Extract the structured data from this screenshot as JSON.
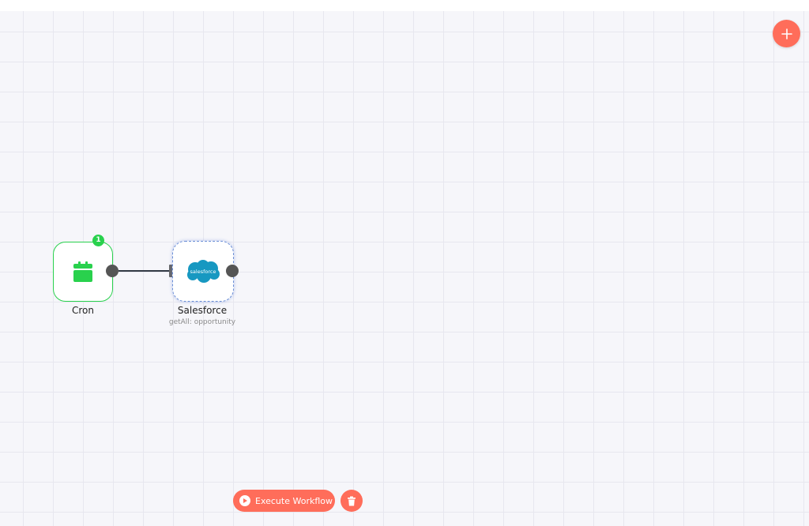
{
  "canvas": {
    "background_color": "#f6f6fa",
    "grid_color": "#e7e7ef"
  },
  "toolbar": {
    "add_node_icon": "plus-icon",
    "accent_color": "#ff6d5a"
  },
  "nodes": [
    {
      "label": "Cron",
      "subtitle": "",
      "icon": "calendar-icon",
      "icon_color": "#29d14d",
      "badge": "1",
      "border_color": "#29d14d"
    },
    {
      "label": "Salesforce",
      "subtitle": "getAll: opportunity",
      "icon": "salesforce-logo-icon",
      "logo_text": "salesforce",
      "logo_color": "#1798c1",
      "selected": true
    }
  ],
  "connection": {
    "from": "Cron",
    "to": "Salesforce"
  },
  "footer": {
    "execute_label": "Execute Workflow",
    "execute_icon": "play-icon",
    "delete_icon": "trash-icon"
  }
}
